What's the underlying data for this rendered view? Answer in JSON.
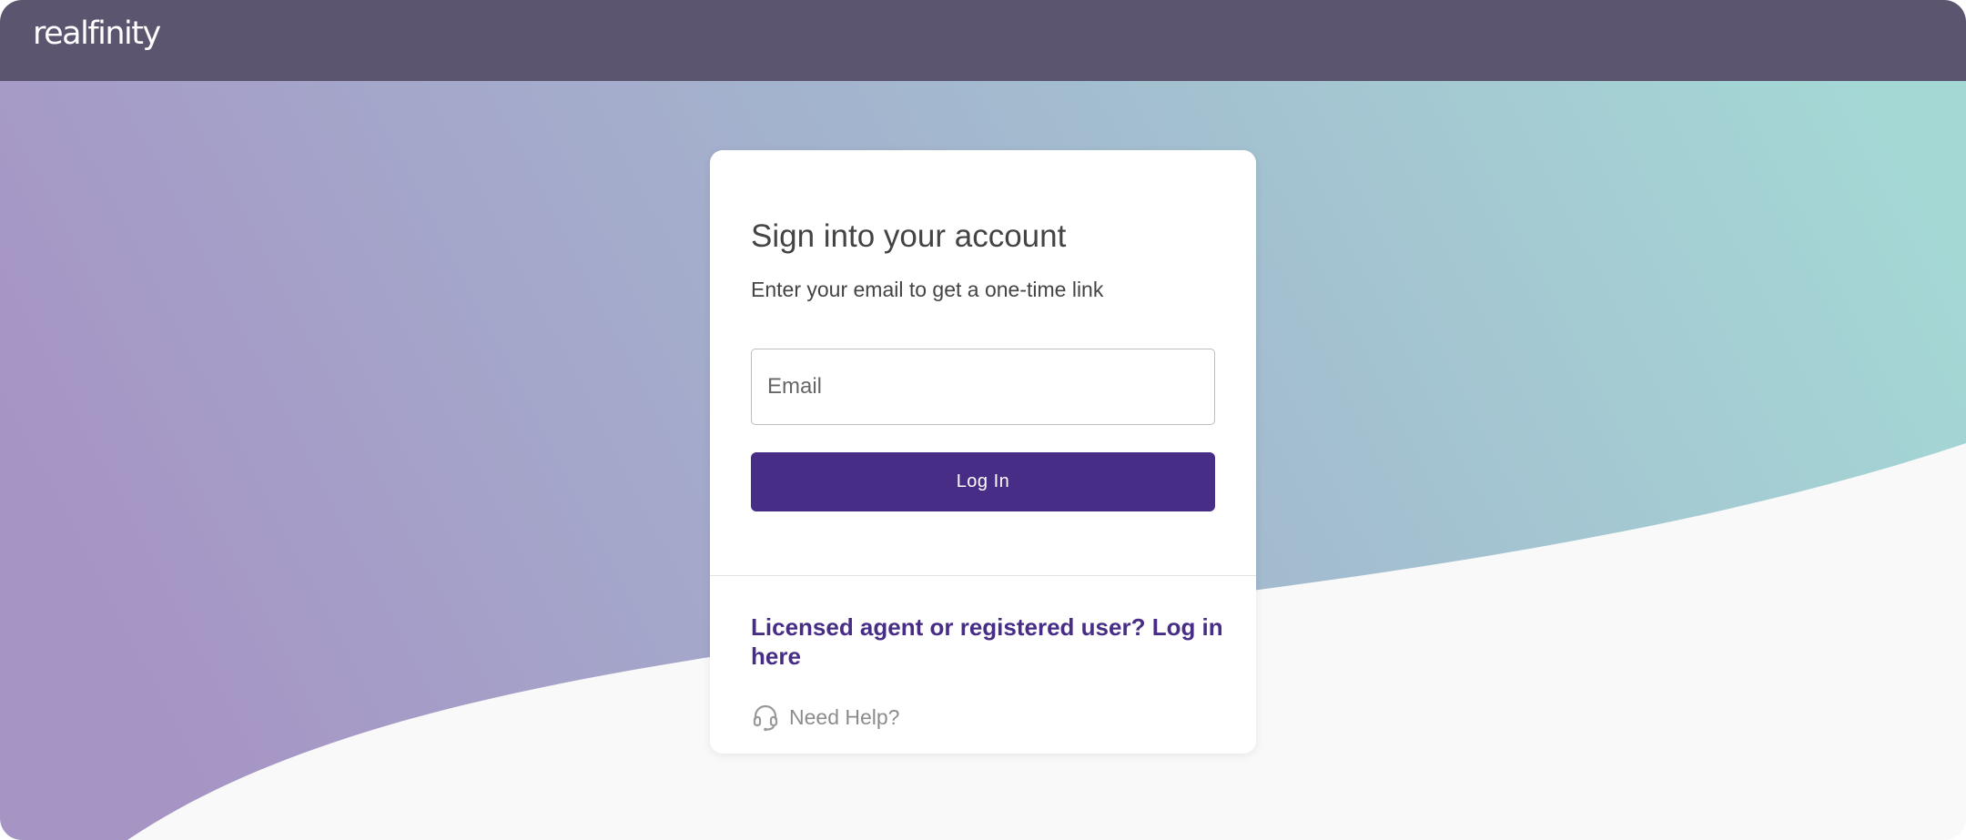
{
  "brand": {
    "logo_text": "realfinity",
    "topbar_color": "#5b556f",
    "accent_color": "#482d87",
    "gradient_start": "#a694c5",
    "gradient_end": "#a4d8d5"
  },
  "login_card": {
    "title": "Sign into your account",
    "subtitle": "Enter your email to get a one-time link",
    "email_field": {
      "placeholder": "Email",
      "value": ""
    },
    "login_button_label": "Log In",
    "agent_link_text": "Licensed agent or registered user?  Log in here",
    "help": {
      "icon": "headset-icon",
      "label": "Need Help?"
    }
  }
}
